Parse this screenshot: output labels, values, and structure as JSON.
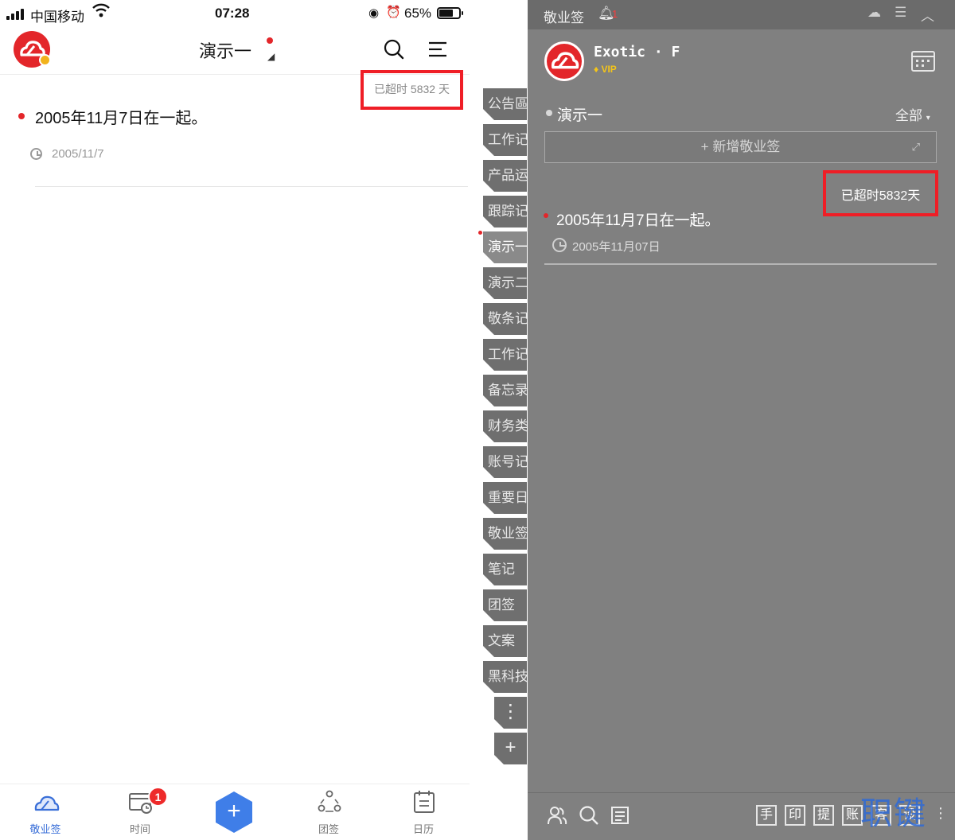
{
  "phone": {
    "status": {
      "carrier": "中国移动",
      "time": "07:28",
      "battery": "65%"
    },
    "header": {
      "title": "演示一"
    },
    "overdue": "已超时 5832 天",
    "note": {
      "text": "2005年11月7日在一起。",
      "date": "2005/11/7"
    },
    "tabs": [
      {
        "label": "敬业签",
        "icon": "cloud-icon",
        "active": true
      },
      {
        "label": "时间",
        "icon": "time-card-icon",
        "badge": "1"
      },
      {
        "label": "",
        "icon": "plus-icon"
      },
      {
        "label": "团签",
        "icon": "team-icon"
      },
      {
        "label": "日历",
        "icon": "calendar-icon"
      }
    ]
  },
  "side_tabs": [
    "公告區",
    "工作记",
    "产品运",
    "跟踪记",
    "演示一",
    "演示二",
    "敬条记",
    "工作记",
    "备忘录",
    "财务类",
    "账号记",
    "重要日",
    "敬业签",
    "笔记",
    "团签",
    "文案",
    "黑科技"
  ],
  "side_buttons": {
    "more": "⋮",
    "add": "+"
  },
  "desktop": {
    "app_name": "敬业签",
    "bell_count": "1",
    "user": {
      "name": "Exotic · F",
      "vip": "VIP"
    },
    "group": "演示一",
    "filter": "全部",
    "new_button": "+ 新增敬业签",
    "overdue": "已超时5832天",
    "note": {
      "text": "2005年11月7日在一起。",
      "date": "2005年11月07日"
    },
    "bottom_keys": [
      "手",
      "印",
      "提",
      "账",
      "客",
      "设"
    ],
    "watermark": "职键号"
  },
  "colors": {
    "brand_red": "#e3262a",
    "accent_blue": "#3a6fd8",
    "highlight": "#ef1e26",
    "desktop_bg": "#808080"
  }
}
